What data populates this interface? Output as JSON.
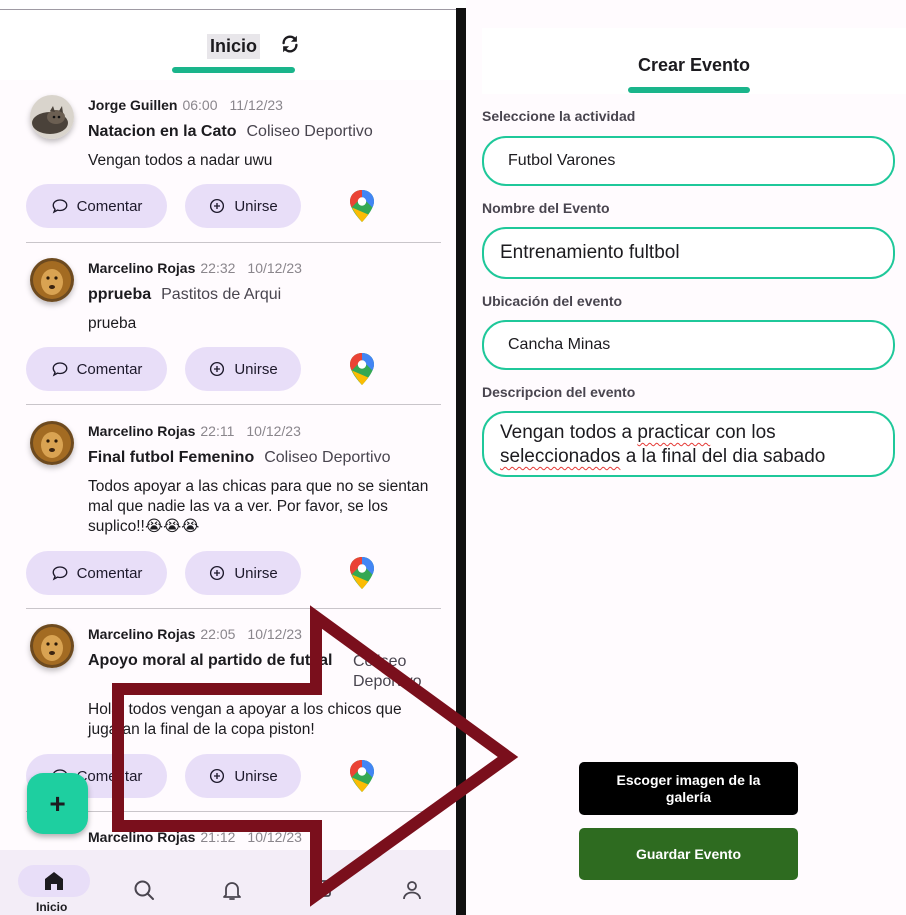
{
  "feed": {
    "title": "Inicio",
    "accent": "#1ab58b",
    "posts": [
      {
        "author": "Jorge Guillen",
        "time": "06:00",
        "date": "11/12/23",
        "title": "Natacion en la Cato",
        "location": "Coliseo Deportivo",
        "body": "Vengan todos a nadar uwu",
        "comment_label": "Comentar",
        "join_label": "Unirse"
      },
      {
        "author": "Marcelino Rojas",
        "time": "22:32",
        "date": "10/12/23",
        "title": "pprueba",
        "location": "Pastitos de Arqui",
        "body": "prueba",
        "comment_label": "Comentar",
        "join_label": "Unirse"
      },
      {
        "author": "Marcelino Rojas",
        "time": "22:11",
        "date": "10/12/23",
        "title": "Final futbol Femenino",
        "location": "Coliseo Deportivo",
        "body": "Todos apoyar a las chicas para que no se sientan mal que nadie las va a ver. Por favor, se los suplico!!😭😭😭",
        "comment_label": "Comentar",
        "join_label": "Unirse"
      },
      {
        "author": "Marcelino Rojas",
        "time": "22:05",
        "date": "10/12/23",
        "title": "Apoyo moral al partido de futsal",
        "location": "Coliseo Deportivo",
        "body": "Hola, todos vengan a apoyar a los chicos que jugaran la final de la copa piston!",
        "comment_label": "Comentar",
        "join_label": "Unirse"
      },
      {
        "author": "Marcelino Rojas",
        "time": "21:12",
        "date": "10/12/23"
      }
    ],
    "fab_label": "+"
  },
  "nav": {
    "home_label": "Inicio",
    "items": [
      "home-icon",
      "search-icon",
      "bell-icon",
      "calendar-icon",
      "profile-icon"
    ]
  },
  "create": {
    "title": "Crear Evento",
    "activity_label": "Seleccione la actividad",
    "activity_value": "Futbol Varones",
    "name_label": "Nombre del Evento",
    "name_value": "Entrenamiento fultbol",
    "location_label": "Ubicación del evento",
    "location_value": "Cancha Minas",
    "desc_label": "Descripcion del evento",
    "desc_value_1": "Vengan todos a ",
    "desc_value_2": "practicar",
    "desc_value_3": " con los",
    "desc_value_4": "seleccionados",
    "desc_value_5": " a la final del dia sabado",
    "gallery_button": "Escoger imagen de la galería",
    "save_button": "Guardar Evento",
    "field_border": "#1fc89a",
    "save_color": "#2e6b20"
  },
  "overlay": {
    "arrow_color": "#7a0f1c"
  }
}
